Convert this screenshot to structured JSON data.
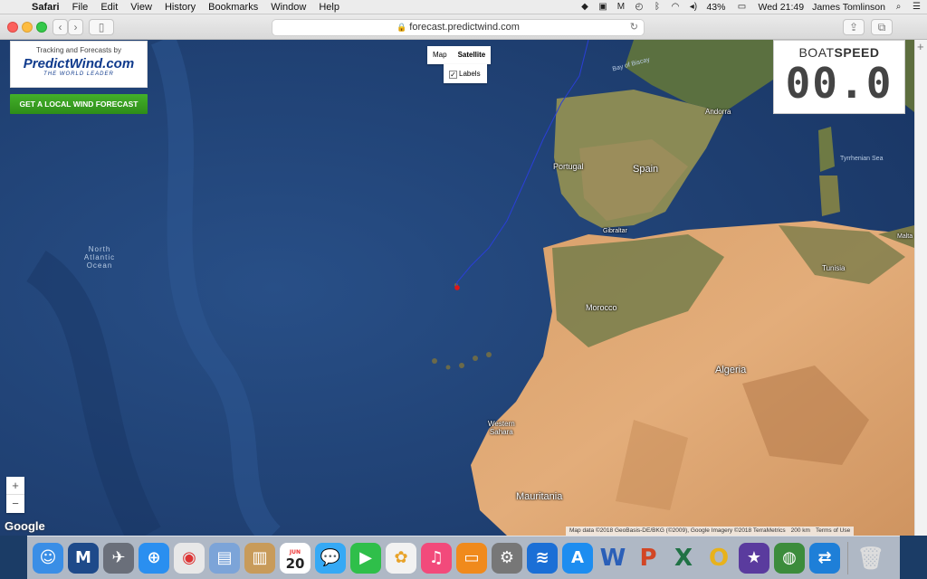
{
  "menubar": {
    "app_name": "Safari",
    "items": [
      "File",
      "Edit",
      "View",
      "History",
      "Bookmarks",
      "Window",
      "Help"
    ],
    "battery": "43%",
    "clock": "Wed 21:49",
    "user": "James Tomlinson"
  },
  "browser": {
    "url": "forecast.predictwind.com"
  },
  "map": {
    "logo_tagline": "Tracking and Forecasts by",
    "logo_name": "PredictWind.com",
    "logo_slogan": "THE WORLD LEADER",
    "wind_button": "GET A LOCAL WIND FORECAST",
    "maptype_map": "Map",
    "maptype_satellite": "Satellite",
    "labels_checkbox": "Labels",
    "labels_checked": "✓",
    "boatspeed_title_a": "BOAT",
    "boatspeed_title_b": "SPEED",
    "boatspeed_value": "00.0",
    "zoom_in": "+",
    "zoom_out": "−",
    "google_logo": "Google",
    "attribution": "Map data ©2018 GeoBasis-DE/BKG (©2009), Google Imagery ©2018 TerraMetrics",
    "scale": "200 km",
    "terms": "Terms of Use",
    "labels": {
      "bay_of_biscay": "Bay of Biscay",
      "andorra": "Andorra",
      "portugal": "Portugal",
      "spain": "Spain",
      "tyrrhenian": "Tyrrhenian Sea",
      "north_atlantic_1": "North",
      "north_atlantic_2": "Atlantic",
      "north_atlantic_3": "Ocean",
      "gibraltar": "Gibraltar",
      "malta": "Malta",
      "tunisia": "Tunisia",
      "morocco": "Morocco",
      "algeria": "Algeria",
      "western_sahara_1": "Western",
      "western_sahara_2": "Sahara",
      "mauritania": "Mauritania"
    }
  },
  "dock": {
    "apps": [
      "finder-icon",
      "malwarebytes-icon",
      "launchpad-icon",
      "safari-icon",
      "chrome-icon",
      "preview-icon",
      "notefile-icon",
      "calendar-icon",
      "messages-icon",
      "facetime-icon",
      "photos-icon",
      "itunes-icon",
      "ibooks-icon",
      "system-preferences-icon",
      "outlook-web-icon",
      "app-store-icon",
      "word-icon",
      "powerpoint-icon",
      "excel-icon",
      "outlook-icon",
      "imovie-icon",
      "world-icon",
      "teamviewer-icon",
      "trash-icon"
    ],
    "calendar_month": "JUN",
    "calendar_day": "20"
  }
}
